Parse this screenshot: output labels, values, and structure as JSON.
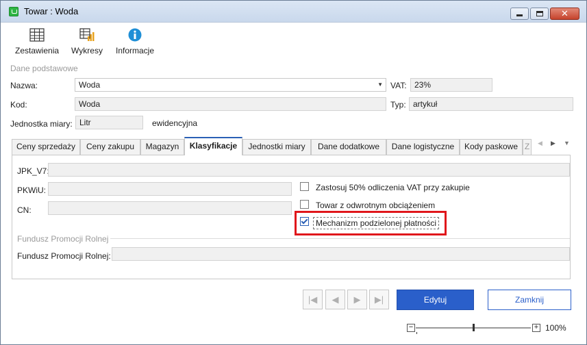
{
  "window": {
    "title": "Towar : Woda"
  },
  "toolbar": {
    "items": [
      {
        "label": "Zestawienia",
        "icon": "table-icon"
      },
      {
        "label": "Wykresy",
        "icon": "chart-icon"
      },
      {
        "label": "Informacje",
        "icon": "info-icon"
      }
    ]
  },
  "basic": {
    "section_label": "Dane podstawowe",
    "name_label": "Nazwa:",
    "name_value": "Woda",
    "vat_label": "VAT:",
    "vat_value": "23%",
    "code_label": "Kod:",
    "code_value": "Woda",
    "type_label": "Typ:",
    "type_value": "artykuł",
    "unit_label": "Jednostka miary:",
    "unit_value": "Litr",
    "unit_note": "ewidencyjna"
  },
  "tabs": [
    {
      "label": "Ceny sprzedaży",
      "active": false
    },
    {
      "label": "Ceny zakupu",
      "active": false
    },
    {
      "label": "Magazyn",
      "active": false
    },
    {
      "label": "Klasyfikacje",
      "active": true
    },
    {
      "label": "Jednostki miary",
      "active": false
    },
    {
      "label": "Dane dodatkowe",
      "active": false
    },
    {
      "label": "Dane logistyczne",
      "active": false
    },
    {
      "label": "Kody paskowe",
      "active": false
    },
    {
      "label": "Z",
      "active": false
    }
  ],
  "classification": {
    "jpk_label": "JPK_V7:",
    "jpk_value": "",
    "pkwiu_label": "PKWiU:",
    "pkwiu_value": "",
    "cn_label": "CN:",
    "cn_value": "",
    "options": [
      {
        "label": "Zastosuj 50% odliczenia VAT przy zakupie",
        "checked": false
      },
      {
        "label": "Towar z odwrotnym obciążeniem",
        "checked": false
      },
      {
        "label": "Mechanizm podzielonej płatności",
        "checked": true
      }
    ],
    "fund_section_label": "Fundusz Promocji Rolnej",
    "fund_label": "Fundusz Promocji Rolnej:",
    "fund_value": ""
  },
  "footer": {
    "edit_label": "Edytuj",
    "close_label": "Zamknij",
    "zoom_label": "100%",
    "zoom_level": 0.5
  },
  "colors": {
    "accent": "#2a5fca",
    "highlight": "#e0161b"
  }
}
